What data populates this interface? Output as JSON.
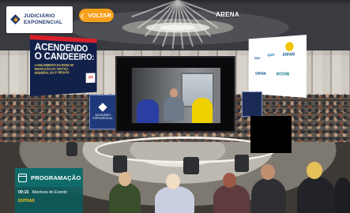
{
  "header": {
    "logo": {
      "line1": "JUDICIÁRIO",
      "line2": "EXPONENCIAL"
    },
    "back_button": "VOLTAR",
    "title": "ARENA"
  },
  "scene": {
    "left_banner": {
      "heading_line1": "ACENDENDO",
      "heading_line2": "O CANDEEIRO:",
      "subtitle": "LANÇAMENTO DA REDE DE INOVAÇÃO DA JUSTIÇA FEDERAL DA 5ª REGIÃO",
      "tag": "JF5"
    },
    "pillar_sign": {
      "line1": "JUDICIÁRIO",
      "line2": "EXPONENCIAL"
    },
    "sponsors": [
      "inov",
      "ajufe",
      "ENFAM",
      "ENFAM",
      "SICOOB"
    ]
  },
  "schedule": {
    "title": "PROGRAMAÇÃO",
    "items": [
      {
        "time": "09:15",
        "label": "Abertura do Evento",
        "action": "ENTRAR"
      }
    ]
  },
  "colors": {
    "accent_orange": "#f5a01c",
    "program_teal": "#0f6b6a",
    "link_yellow": "#f5c518",
    "brand_navy": "#1e3a6d"
  },
  "icons": {
    "back": "chevron-left-icon",
    "schedule": "calendar-icon"
  }
}
